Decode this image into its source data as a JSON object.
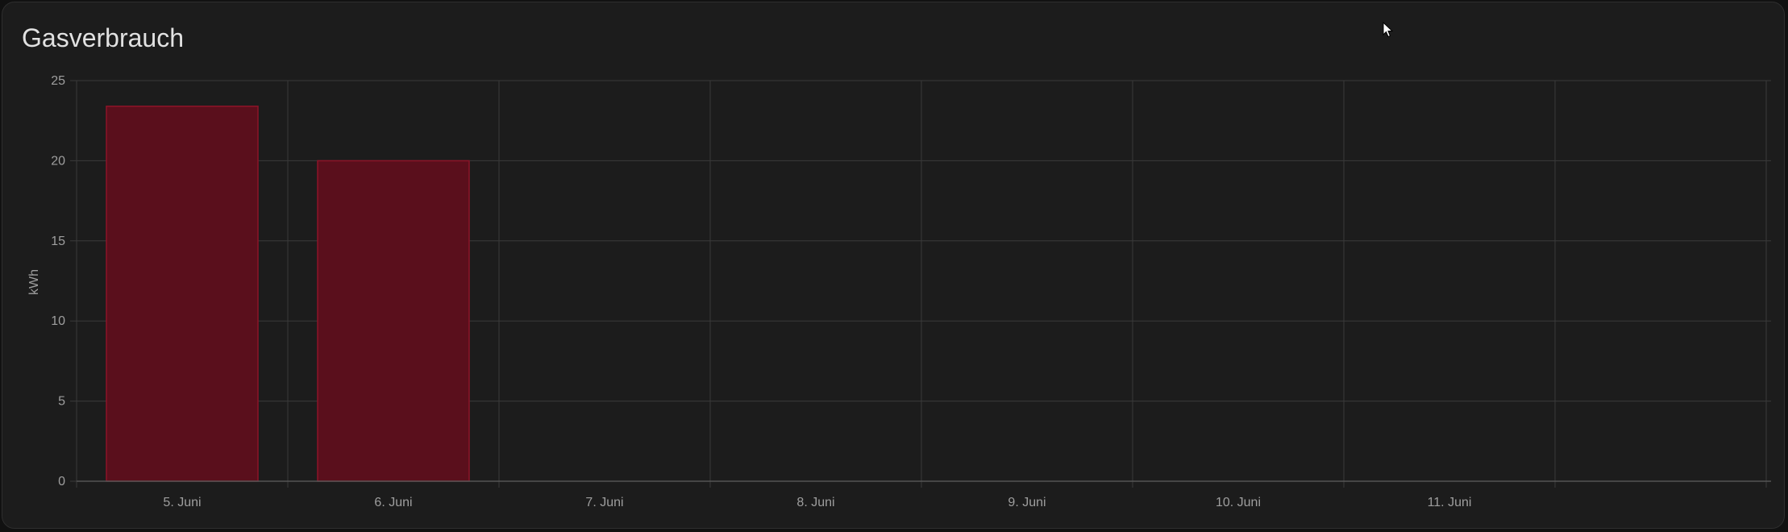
{
  "card": {
    "title": "Gasverbrauch"
  },
  "chart_data": {
    "type": "bar",
    "title": "Gasverbrauch",
    "xlabel": "",
    "ylabel": "kWh",
    "categories": [
      "5. Juni",
      "6. Juni",
      "7. Juni",
      "8. Juni",
      "9. Juni",
      "10. Juni",
      "11. Juni"
    ],
    "series": [
      {
        "values": [
          23.4,
          20.0,
          null,
          null,
          null,
          null,
          null
        ],
        "color": "#5a0f1c",
        "border_color": "#8c1428"
      }
    ],
    "ylim": [
      0,
      25
    ],
    "yticks": [
      0,
      5,
      10,
      15,
      20,
      25
    ],
    "grid": true,
    "legend": "none"
  },
  "colors": {
    "background": "#1c1c1c",
    "grid": "#3a3a3a",
    "text": "#9e9e9e",
    "title": "#e1e1e1"
  }
}
